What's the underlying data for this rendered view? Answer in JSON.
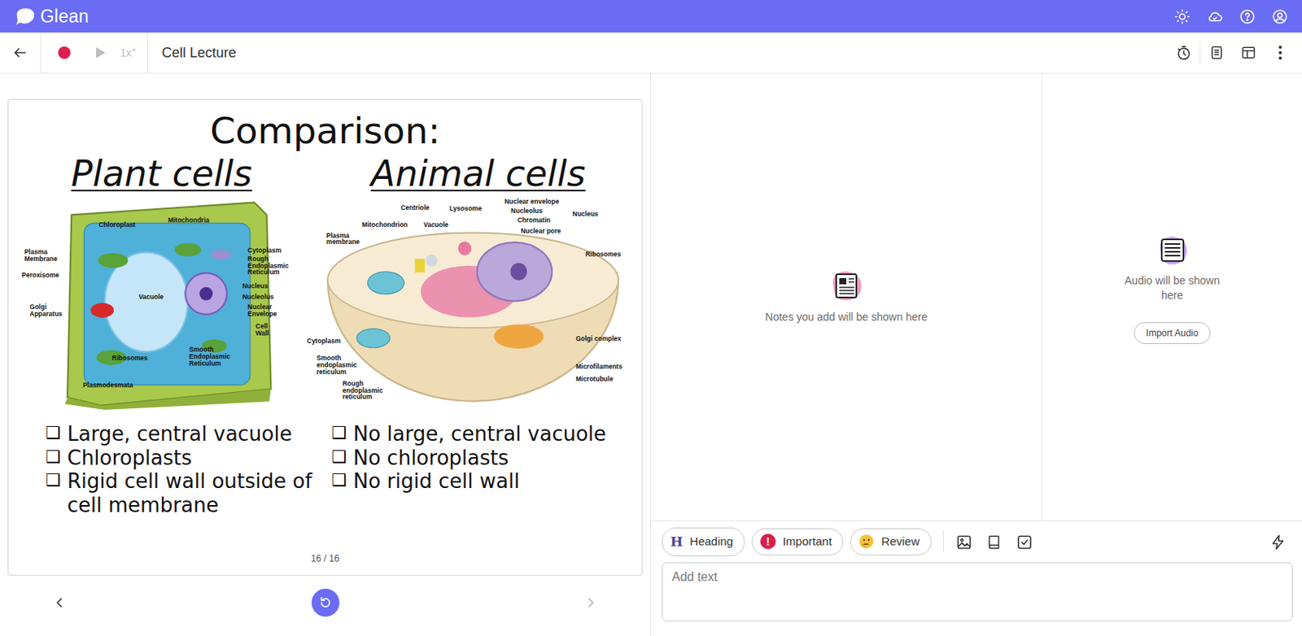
{
  "app": {
    "name": "Glean"
  },
  "player": {
    "speed": "1x",
    "speed_badge": "+",
    "disabled": true
  },
  "lecture": {
    "title": "Cell Lecture"
  },
  "slide": {
    "title": "Comparison:",
    "columns": [
      {
        "heading": "Plant cells",
        "figure_labels": [
          "Chloroplast",
          "Mitochondria",
          "Plasma Membrane",
          "Peroxisome",
          "Golgi Apparatus",
          "Vacuole",
          "Cytoplasm",
          "Rough Endoplasmic Reticulum",
          "Nucleus",
          "Nucleolus",
          "Nuclear Envelope",
          "Cell Wall",
          "Ribosomes",
          "Smooth Endoplasmic Reticulum",
          "Plasmodesmata"
        ],
        "bullets": [
          {
            "mark": "❑",
            "text": "Large, central vacuole"
          },
          {
            "mark": "❑",
            "text": "Chloroplasts"
          },
          {
            "mark": "❑",
            "text": "Rigid cell wall outside of cell membrane"
          }
        ]
      },
      {
        "heading": "Animal cells",
        "figure_labels": [
          "Centriole",
          "Lysosome",
          "Nuclear envelope",
          "Nucleolus",
          "Chromatin",
          "Nuclear pore",
          "Nucleus",
          "Mitochondrion",
          "Vacuole",
          "Plasma membrane",
          "Ribosomes",
          "Golgi complex",
          "Microfilaments",
          "Microtubule",
          "Cytoplasm",
          "Smooth endoplasmic reticulum",
          "Rough endoplasmic reticulum"
        ],
        "bullets": [
          {
            "mark": "❑",
            "text": "No large, central vacuole"
          },
          {
            "mark": "❑",
            "text": "No chloroplasts"
          },
          {
            "mark": "❑",
            "text": "No rigid cell wall"
          }
        ]
      }
    ],
    "page": "16 / 16"
  },
  "slide_nav": {
    "previous_disabled": false,
    "next_disabled": true
  },
  "notes": {
    "empty_text": "Notes you add will be shown here"
  },
  "audio": {
    "empty_text": "Audio will be shown here",
    "button": "Import Audio"
  },
  "editor": {
    "tags": [
      {
        "kind": "letter",
        "icon": "H",
        "label": "Heading"
      },
      {
        "kind": "alert",
        "icon": "!",
        "label": "Important"
      },
      {
        "kind": "emoji",
        "label": "Review"
      }
    ],
    "placeholder": "Add text"
  }
}
